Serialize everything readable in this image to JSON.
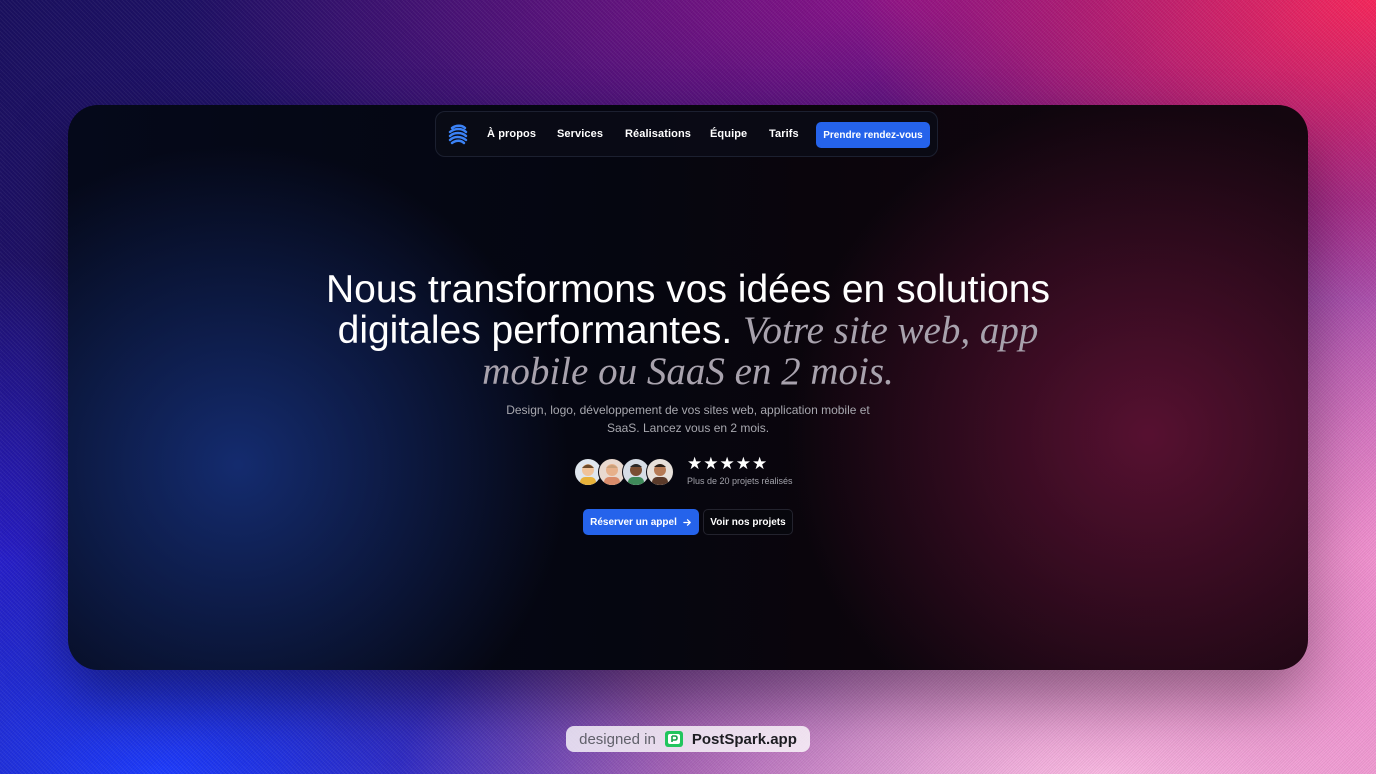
{
  "nav": {
    "logo_icon": "stacked-waves-logo-icon",
    "items": [
      {
        "label": "À propos"
      },
      {
        "label": "Services"
      },
      {
        "label": "Réalisations"
      },
      {
        "label": "Équipe"
      },
      {
        "label": "Tarifs"
      }
    ],
    "cta_label": "Prendre rendez-vous"
  },
  "hero": {
    "headline_line1": "Nous transformons vos idées en solutions",
    "headline_line2_plain": "digitales performantes.",
    "headline_line2_italic": "Votre site web, app",
    "headline_line3_italic": "mobile ou SaaS en 2 mois.",
    "subtitle_line1": "Design, logo, développement de vos sites web, application mobile et",
    "subtitle_line2": "SaaS. Lancez vous en 2 mois.",
    "rating_stars": 5,
    "rating_caption": "Plus de 20 projets réalisés",
    "primary_button": "Réserver un appel",
    "primary_button_icon": "arrow-right-icon",
    "secondary_button": "Voir nos projets"
  },
  "footer_badge": {
    "prefix": "designed in",
    "brand": "PostSpark.app",
    "icon": "postspark-logo-icon"
  },
  "colors": {
    "accent": "#2563eb",
    "card_background": "#050610",
    "italic_text": "#a8a2ad"
  }
}
